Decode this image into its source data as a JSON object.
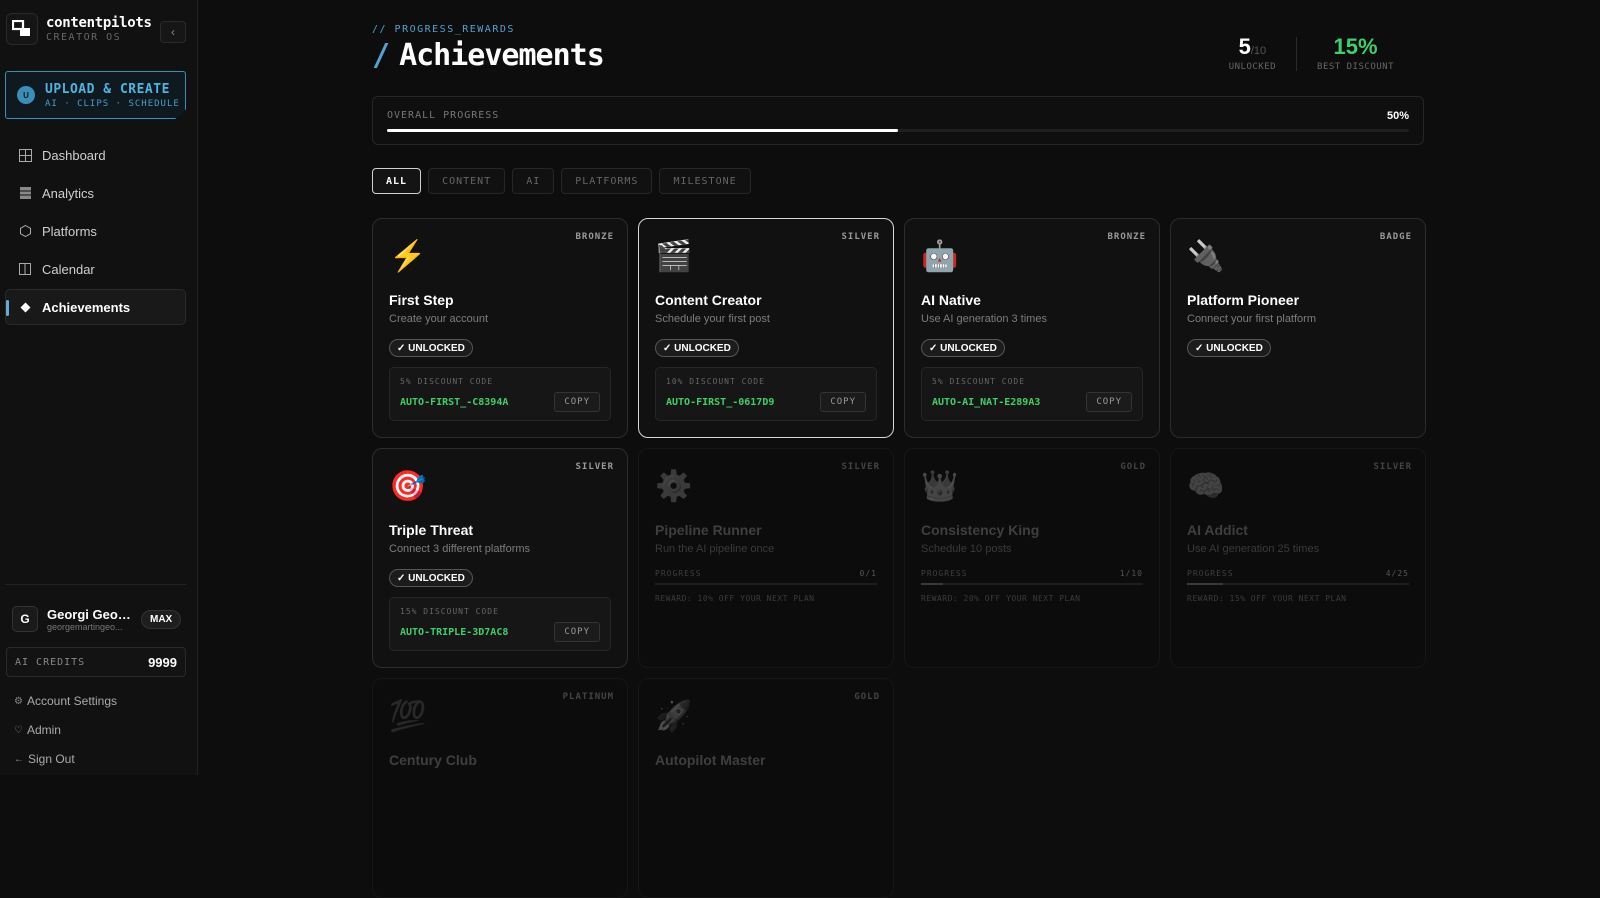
{
  "brand": {
    "name": "contentpilots",
    "subtitle": "CREATOR OS"
  },
  "upload": {
    "avatar": "U",
    "title": "UPLOAD & CREATE",
    "subtitle": "AI · CLIPS · SCHEDULE"
  },
  "nav": [
    {
      "label": "Dashboard",
      "icon": "grid-icon"
    },
    {
      "label": "Analytics",
      "icon": "bar-chart-icon"
    },
    {
      "label": "Platforms",
      "icon": "hexagon-icon"
    },
    {
      "label": "Calendar",
      "icon": "calendar-icon"
    },
    {
      "label": "Achievements",
      "icon": "diamond-icon",
      "active": true
    }
  ],
  "user": {
    "initial": "G",
    "name": "Georgi Geor...",
    "email": "georgemartingeo...",
    "plan": "MAX"
  },
  "credits": {
    "label": "AI CREDITS",
    "value": "9999"
  },
  "links": {
    "account": "Account Settings",
    "admin": "Admin",
    "signout": "Sign Out"
  },
  "page": {
    "eyebrow": "// PROGRESS_REWARDS",
    "slash": "/",
    "title": "Achievements"
  },
  "stats": {
    "unlocked": "5",
    "unlocked_total": "/10",
    "unlocked_label": "UNLOCKED",
    "discount": "15%",
    "discount_label": "BEST DISCOUNT"
  },
  "progress": {
    "label": "OVERALL PROGRESS",
    "value": "50%",
    "fraction": 0.5
  },
  "tabs": [
    "ALL",
    "CONTENT",
    "AI",
    "PLATFORMS",
    "MILESTONE"
  ],
  "colors": {
    "accent": "#4fa3cf",
    "code_green": "#3ecf6a"
  },
  "cards": [
    {
      "tier": "BRONZE",
      "emoji": "⚡",
      "title": "First Step",
      "desc": "Create your account",
      "unlocked": "✓ UNLOCKED",
      "code_label": "5% DISCOUNT CODE",
      "code": "AUTO-FIRST_-C8394A",
      "copy": "COPY"
    },
    {
      "tier": "SILVER",
      "emoji": "🎬",
      "title": "Content Creator",
      "desc": "Schedule your first post",
      "unlocked": "✓ UNLOCKED",
      "code_label": "10% DISCOUNT CODE",
      "code": "AUTO-FIRST_-0617D9",
      "copy": "COPY"
    },
    {
      "tier": "BRONZE",
      "emoji": "🤖",
      "title": "AI Native",
      "desc": "Use AI generation 3 times",
      "unlocked": "✓ UNLOCKED",
      "code_label": "5% DISCOUNT CODE",
      "code": "AUTO-AI_NAT-E289A3",
      "copy": "COPY"
    },
    {
      "tier": "BADGE",
      "emoji": "🔌",
      "title": "Platform Pioneer",
      "desc": "Connect your first platform",
      "unlocked": "✓ UNLOCKED"
    },
    {
      "tier": "SILVER",
      "emoji": "🎯",
      "title": "Triple Threat",
      "desc": "Connect 3 different platforms",
      "unlocked": "✓ UNLOCKED",
      "code_label": "15% DISCOUNT CODE",
      "code": "AUTO-TRIPLE-3D7AC8",
      "copy": "COPY"
    },
    {
      "tier": "SILVER",
      "emoji": "⚙️",
      "title": "Pipeline Runner",
      "desc": "Run the AI pipeline once",
      "progress_label": "PROGRESS",
      "progress_count": "0/1",
      "progress_fraction": 0,
      "reward": "REWARD: 10% OFF YOUR NEXT PLAN"
    },
    {
      "tier": "GOLD",
      "emoji": "👑",
      "title": "Consistency King",
      "desc": "Schedule 10 posts",
      "progress_label": "PROGRESS",
      "progress_count": "1/10",
      "progress_fraction": 0.1,
      "reward": "REWARD: 20% OFF YOUR NEXT PLAN"
    },
    {
      "tier": "SILVER",
      "emoji": "🧠",
      "title": "AI Addict",
      "desc": "Use AI generation 25 times",
      "progress_label": "PROGRESS",
      "progress_count": "4/25",
      "progress_fraction": 0.16,
      "reward": "REWARD: 15% OFF YOUR NEXT PLAN"
    },
    {
      "tier": "PLATINUM",
      "emoji": "💯",
      "title": "Century Club"
    },
    {
      "tier": "GOLD",
      "emoji": "🚀",
      "title": "Autopilot Master"
    }
  ]
}
